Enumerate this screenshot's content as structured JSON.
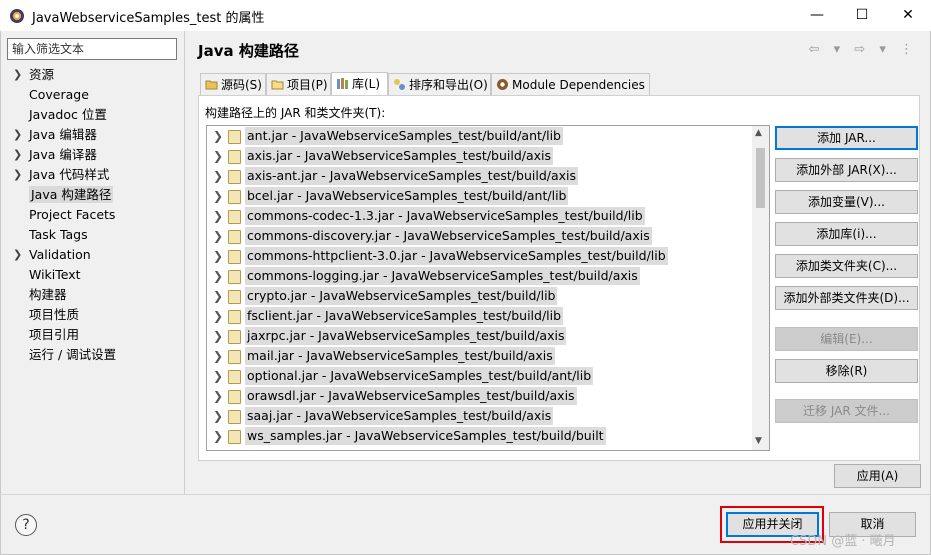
{
  "window": {
    "title": "JavaWebserviceSamples_test 的属性",
    "minimize_glyph": "—",
    "maximize_glyph": "☐",
    "close_glyph": "✕"
  },
  "sidebar": {
    "filter_placeholder": "输入筛选文本",
    "items": [
      {
        "label": "资源",
        "expandable": true
      },
      {
        "label": "Coverage",
        "expandable": false
      },
      {
        "label": "Javadoc 位置",
        "expandable": false
      },
      {
        "label": "Java 编辑器",
        "expandable": true
      },
      {
        "label": "Java 编译器",
        "expandable": true
      },
      {
        "label": "Java 代码样式",
        "expandable": true
      },
      {
        "label": "Java 构建路径",
        "expandable": false,
        "selected": true
      },
      {
        "label": "Project Facets",
        "expandable": false
      },
      {
        "label": "Task Tags",
        "expandable": false
      },
      {
        "label": "Validation",
        "expandable": true
      },
      {
        "label": "WikiText",
        "expandable": false
      },
      {
        "label": "构建器",
        "expandable": false
      },
      {
        "label": "项目性质",
        "expandable": false
      },
      {
        "label": "项目引用",
        "expandable": false
      },
      {
        "label": "运行 / 调试设置",
        "expandable": false
      }
    ]
  },
  "page": {
    "title": "Java 构建路径",
    "nav_icons": "⇦ ▾ ⇨ ▾ ⋮"
  },
  "tabs": [
    {
      "label": "源码(S)",
      "icon": "source-folder-icon"
    },
    {
      "label": "项目(P)",
      "icon": "project-icon"
    },
    {
      "label": "库(L)",
      "icon": "library-icon",
      "active": true
    },
    {
      "label": "排序和导出(O)",
      "icon": "order-export-icon"
    },
    {
      "label": "Module Dependencies",
      "icon": "module-icon"
    }
  ],
  "libraries": {
    "label": "构建路径上的 JAR 和类文件夹(T):",
    "items": [
      "ant.jar - JavaWebserviceSamples_test/build/ant/lib",
      "axis.jar - JavaWebserviceSamples_test/build/axis",
      "axis-ant.jar - JavaWebserviceSamples_test/build/axis",
      "bcel.jar - JavaWebserviceSamples_test/build/ant/lib",
      "commons-codec-1.3.jar - JavaWebserviceSamples_test/build/lib",
      "commons-discovery.jar - JavaWebserviceSamples_test/build/axis",
      "commons-httpclient-3.0.jar - JavaWebserviceSamples_test/build/lib",
      "commons-logging.jar - JavaWebserviceSamples_test/build/axis",
      "crypto.jar - JavaWebserviceSamples_test/build/lib",
      "fsclient.jar - JavaWebserviceSamples_test/build/lib",
      "jaxrpc.jar - JavaWebserviceSamples_test/build/axis",
      "mail.jar - JavaWebserviceSamples_test/build/axis",
      "optional.jar - JavaWebserviceSamples_test/build/ant/lib",
      "orawsdl.jar - JavaWebserviceSamples_test/build/axis",
      "saaj.jar - JavaWebserviceSamples_test/build/axis",
      "ws_samples.jar - JavaWebserviceSamples_test/build/built"
    ]
  },
  "buttons": {
    "add_jar": "添加 JAR...",
    "add_external_jar": "添加外部 JAR(X)...",
    "add_variable": "添加变量(V)...",
    "add_library": "添加库(i)...",
    "add_class_folder": "添加类文件夹(C)...",
    "add_external_class_folder": "添加外部类文件夹(D)...",
    "edit": "编辑(E)...",
    "remove": "移除(R)",
    "migrate_jar": "迁移 JAR 文件...",
    "apply": "应用(A)",
    "apply_and_close": "应用并关闭",
    "cancel": "取消"
  },
  "help_glyph": "?",
  "watermark": "CSDN @蓝 · 曦月",
  "colors": {
    "highlight_border": "#e0000a",
    "focus_border": "#0078d7"
  }
}
